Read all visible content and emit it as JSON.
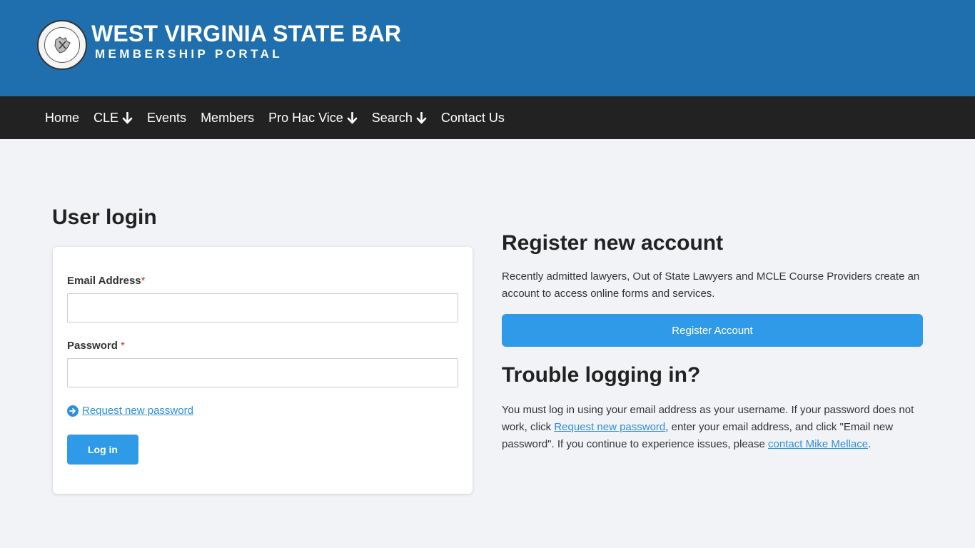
{
  "header": {
    "title": "WEST VIRGINIA STATE BAR",
    "subtitle": "MEMBERSHIP PORTAL",
    "logo_icon": "state-seal-icon",
    "bg_color": "#1f6fae"
  },
  "nav": {
    "items": [
      {
        "label": "Home",
        "dropdown": false
      },
      {
        "label": "CLE",
        "dropdown": true
      },
      {
        "label": "Events",
        "dropdown": false
      },
      {
        "label": "Members",
        "dropdown": false
      },
      {
        "label": "Pro Hac Vice",
        "dropdown": true
      },
      {
        "label": "Search",
        "dropdown": true
      },
      {
        "label": "Contact Us",
        "dropdown": false
      }
    ]
  },
  "login": {
    "heading": "User login",
    "email_label": "Email Address",
    "email_value": "",
    "password_label": "Password",
    "password_value": "",
    "required_mark": "*",
    "reset_link": "Request new password",
    "submit_label": "Log in"
  },
  "register": {
    "heading": "Register new account",
    "description": "Recently admitted lawyers, Out of State Lawyers and MCLE Course Providers create an account to access online forms and services.",
    "button_label": "Register Account"
  },
  "trouble": {
    "heading": "Trouble logging in?",
    "text_1": "You must log in using your email address as your username. If your password does not work, click ",
    "link_1": "Request new password",
    "text_2": ", enter your email address, and click \"Email new password\". If you continue to experience issues, please ",
    "link_2": "contact Mike Mellace",
    "text_3": "."
  },
  "colors": {
    "accent": "#2f9be8",
    "link": "#2f8fd8",
    "nav_bg": "#222222",
    "required": "#c0392b"
  }
}
